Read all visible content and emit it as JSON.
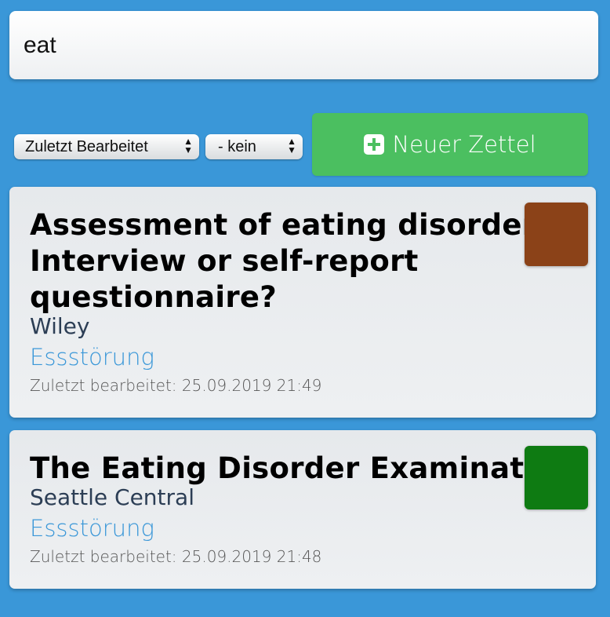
{
  "search": {
    "value": "eat"
  },
  "sort": {
    "selected": "Zuletzt Bearbeitet",
    "arrows_up": "▲",
    "arrows_down": "▼"
  },
  "filter": {
    "selected": "- kein"
  },
  "new_button": {
    "label": "Neuer Zettel",
    "icon": "plus-square-icon"
  },
  "colors": {
    "background": "#3a97d8",
    "button": "#4bbf60",
    "tag": "#3a97d8"
  },
  "cards": [
    {
      "title": "Assessment of eating disorders: Interview or self-report questionnaire?",
      "publisher": "Wiley",
      "tag": "Essstörung",
      "date": "Zuletzt bearbeitet: 25.09.2019 21:49",
      "color": "#8b4218"
    },
    {
      "title": "The Eating Disorder Examination",
      "publisher": "Seattle Central",
      "tag": "Essstörung",
      "date": "Zuletzt bearbeitet: 25.09.2019 21:48",
      "color": "#0e7b12"
    }
  ]
}
